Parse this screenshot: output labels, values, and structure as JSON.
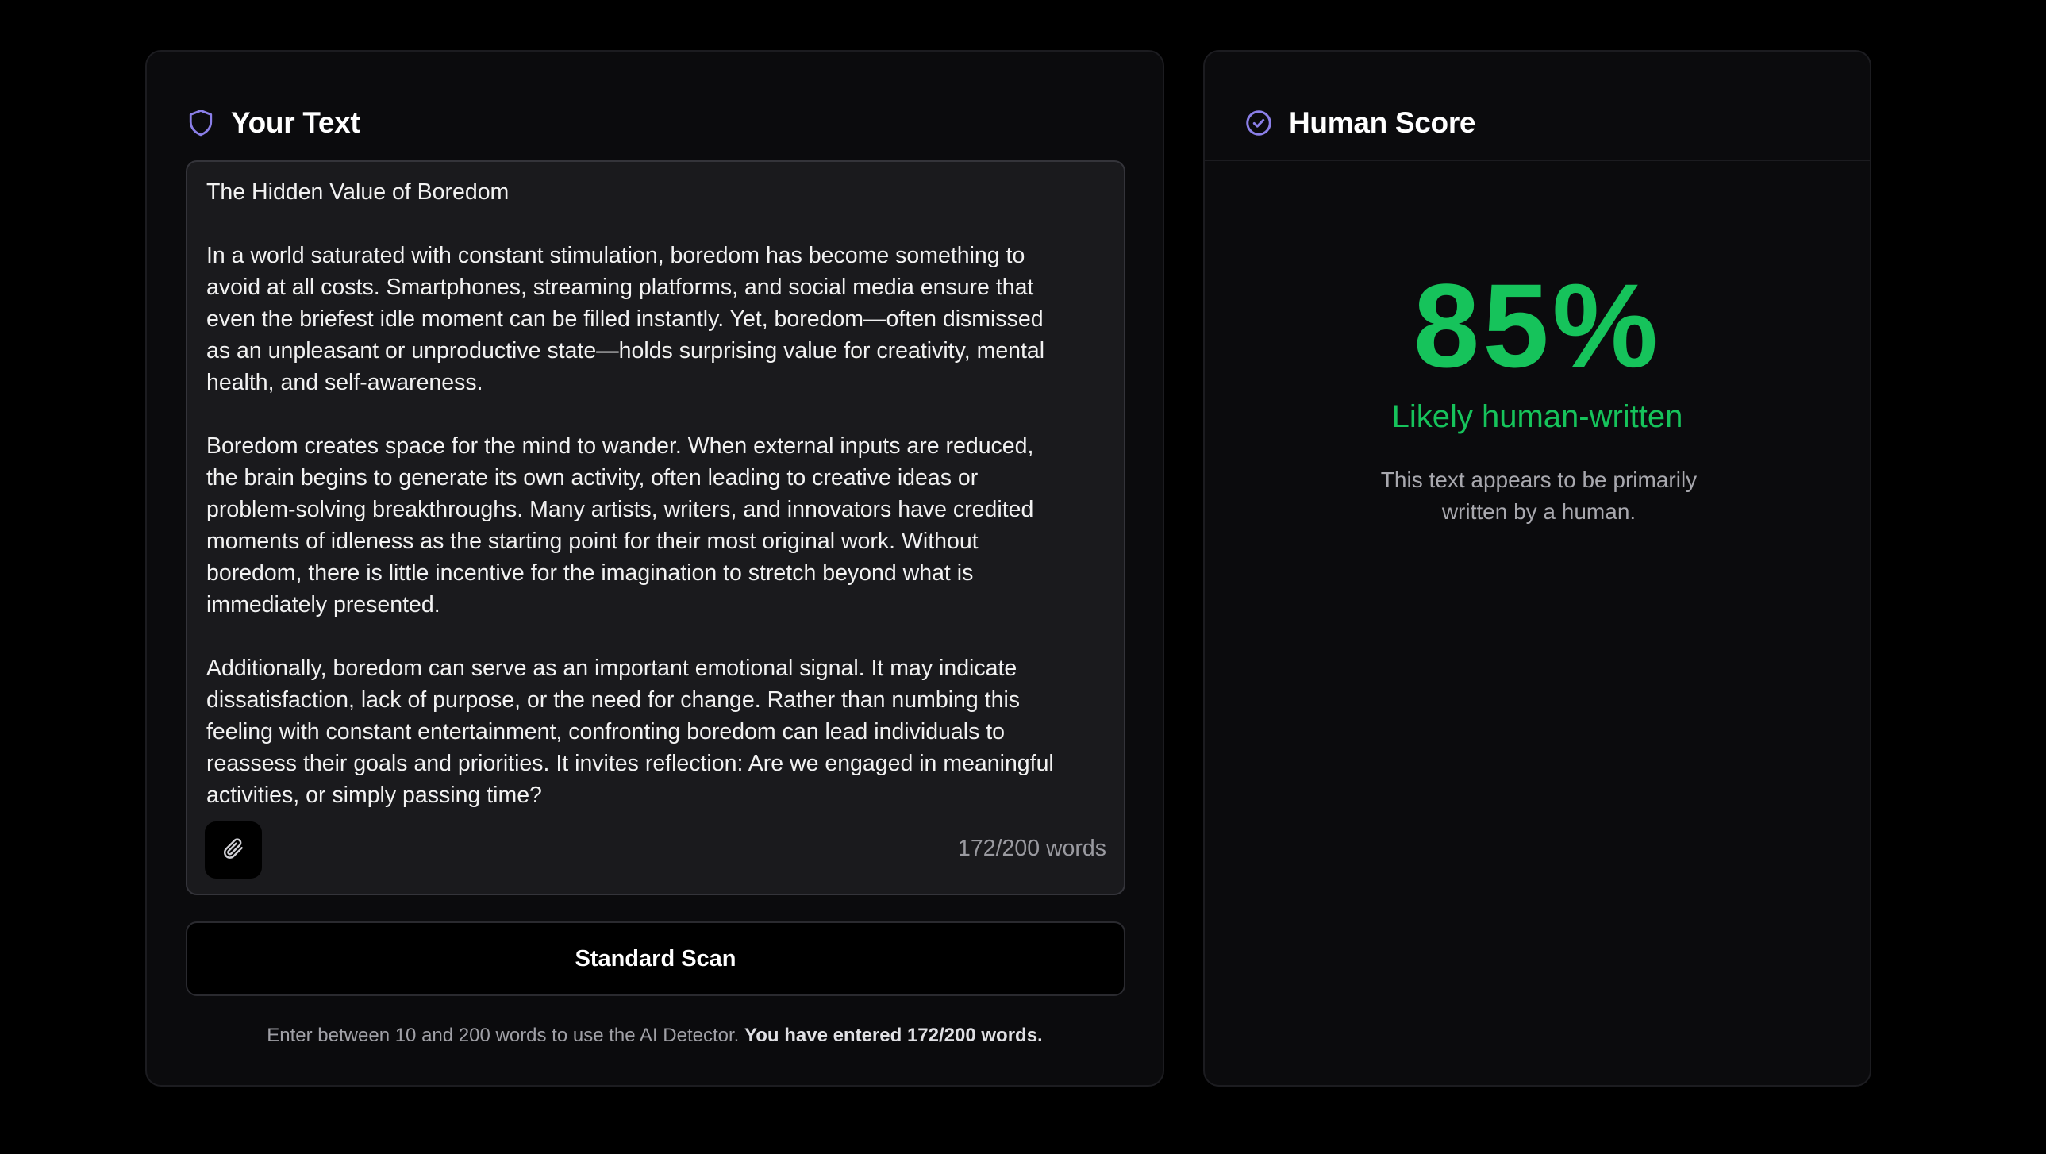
{
  "left_panel": {
    "title": "Your Text",
    "title_icon": "shield-icon",
    "text": "The Hidden Value of Boredom\n\nIn a world saturated with constant stimulation, boredom has become something to\navoid at all costs. Smartphones, streaming platforms, and social media ensure that\neven the briefest idle moment can be filled instantly. Yet, boredom—often dismissed\nas an unpleasant or unproductive state—holds surprising value for creativity, mental\nhealth, and self-awareness.\n\nBoredom creates space for the mind to wander. When external inputs are reduced,\nthe brain begins to generate its own activity, often leading to creative ideas or\nproblem-solving breakthroughs. Many artists, writers, and innovators have credited\nmoments of idleness as the starting point for their most original work. Without\nboredom, there is little incentive for the imagination to stretch beyond what is\nimmediately presented.\n\nAdditionally, boredom can serve as an important emotional signal. It may indicate\ndissatisfaction, lack of purpose, or the need for change. Rather than numbing this\nfeeling with constant entertainment, confronting boredom can lead individuals to\nreassess their goals and priorities. It invites reflection: Are we engaged in meaningful\nactivities, or simply passing time?",
    "attach_icon": "paperclip-icon",
    "word_count": "172/200 words",
    "scan_button_label": "Standard Scan",
    "footer_note": "Enter between 10 and 200 words to use the AI Detector.",
    "footer_note_strong": "You have entered 172/200 words."
  },
  "right_panel": {
    "title": "Human Score",
    "title_icon": "check-circle-icon",
    "score": "85%",
    "score_label": "Likely human-written",
    "score_description": "This text appears to be primarily written by a human."
  },
  "colors": {
    "background": "#000000",
    "card": "#0b0b0d",
    "accent_icon": "#8b7fe8",
    "score_green": "#16c35b"
  }
}
